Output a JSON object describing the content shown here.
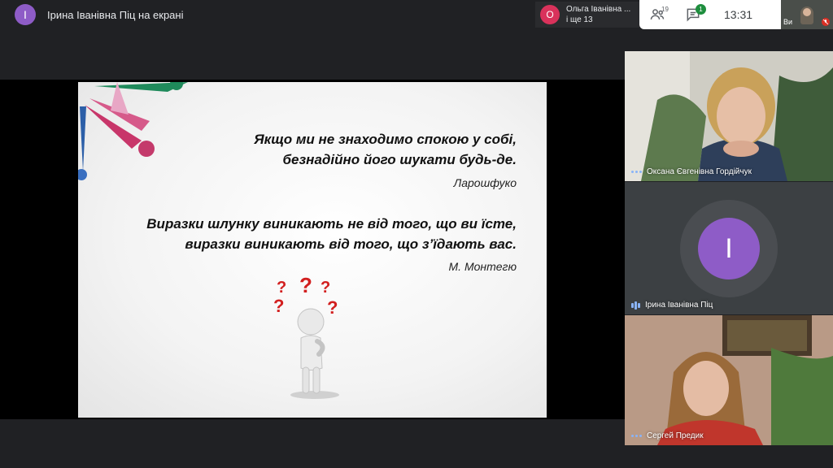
{
  "top_bar": {
    "presenter_initial": "I",
    "presenter_title": "Ірина Іванівна Піц на екрані",
    "other_presenter": {
      "initial": "О",
      "name": "Ольга Іванівна ...",
      "more": "і ще 13"
    },
    "people_count": "19",
    "chat_badge": "1",
    "clock": "13:31",
    "self_label": "Ви"
  },
  "slide": {
    "quote1_line1": "Якщо ми не знаходимо спокою у собі,",
    "quote1_line2": "безнадійно його шукати будь-де.",
    "author1": "Ларошфуко",
    "quote2_line1": "Виразки шлунку виникають не від того, що ви їсте,",
    "quote2_line2": "виразки виникають від того, що з’їдають вас.",
    "author2": "М. Монтегю"
  },
  "participants": [
    {
      "name": "Оксана Євгенівна Гордійчук"
    },
    {
      "name": "Ірина Іванівна Піц",
      "initial": "I"
    },
    {
      "name": "Сергей Предик"
    }
  ],
  "colors": {
    "accent_purple": "#8e5cc7",
    "accent_pink": "#d9325b",
    "badge_green": "#1e8e3e",
    "indicator_blue": "#8ab4f8"
  }
}
